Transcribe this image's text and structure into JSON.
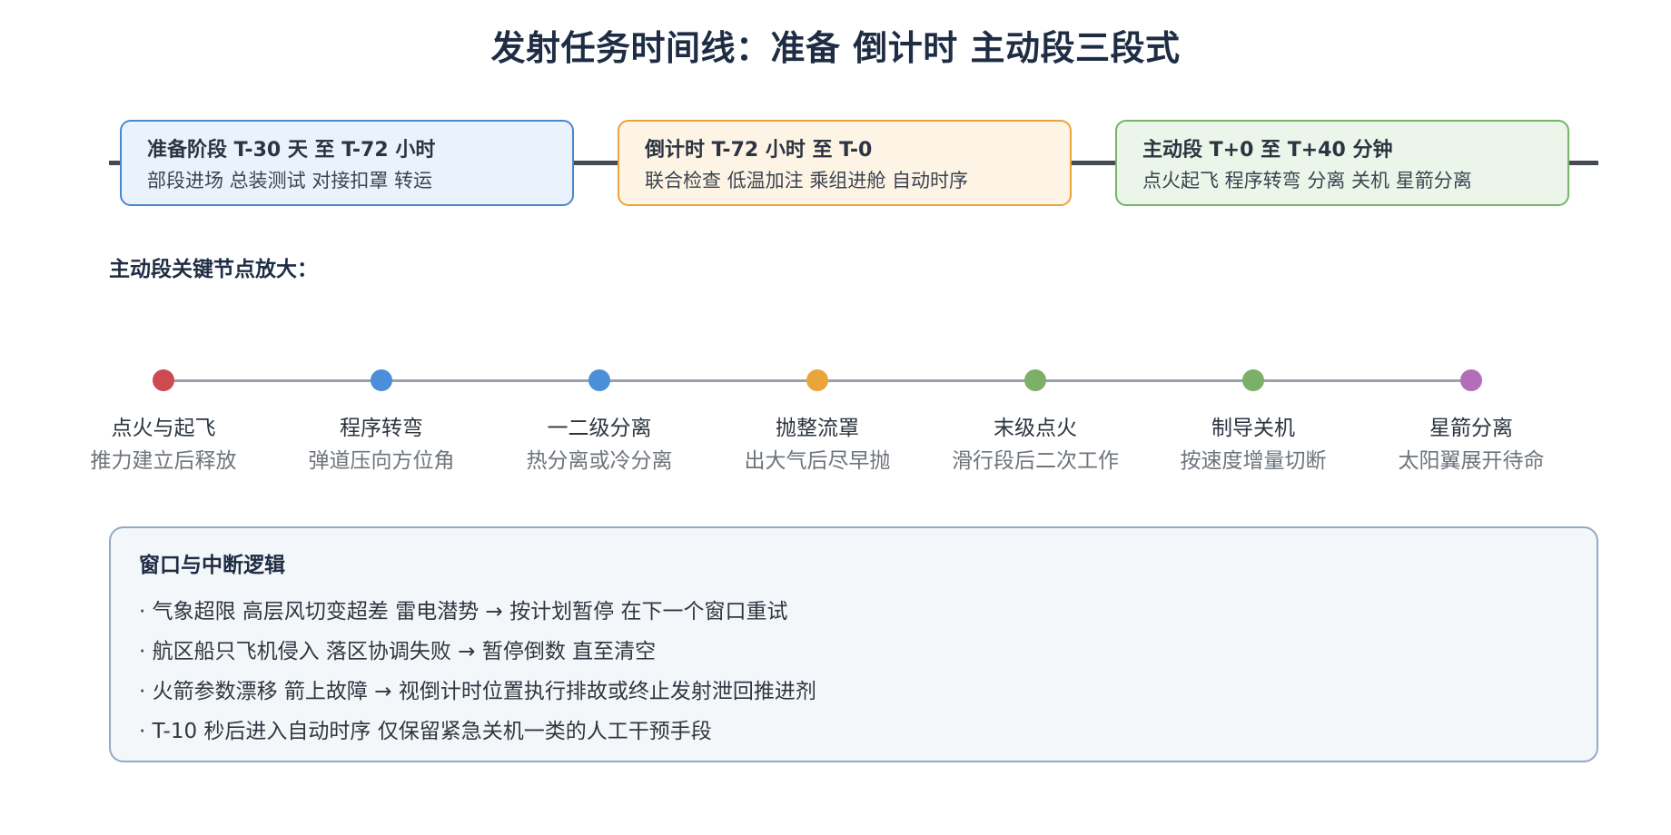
{
  "title": "发射任务时间线：准备 倒计时 主动段三段式",
  "phases": [
    {
      "title": "准备阶段 T-30 天 至 T-72 小时",
      "desc": "部段进场 总装测试 对接扣罩 转运",
      "color": "#4b87cc"
    },
    {
      "title": "倒计时 T-72 小时 至 T-0",
      "desc": "联合检查 低温加注 乘组进舱 自动时序",
      "color": "#e9a53a"
    },
    {
      "title": "主动段 T+0 至 T+40 分钟",
      "desc": "点火起飞 程序转弯 分离 关机 星箭分离",
      "color": "#77b36b"
    }
  ],
  "ascent_heading": "主动段关键节点放大：",
  "nodes": [
    {
      "label": "点火与起飞",
      "desc": "推力建立后释放",
      "color": "#cd4a50"
    },
    {
      "label": "程序转弯",
      "desc": "弹道压向方位角",
      "color": "#4b8fd8"
    },
    {
      "label": "一二级分离",
      "desc": "热分离或冷分离",
      "color": "#4b8fd8"
    },
    {
      "label": "抛整流罩",
      "desc": "出大气后尽早抛",
      "color": "#e9a53a"
    },
    {
      "label": "末级点火",
      "desc": "滑行段后二次工作",
      "color": "#7cb068"
    },
    {
      "label": "制导关机",
      "desc": "按速度增量切断",
      "color": "#7cb068"
    },
    {
      "label": "星箭分离",
      "desc": "太阳翼展开待命",
      "color": "#b36db9"
    }
  ],
  "logic": {
    "title": "窗口与中断逻辑",
    "items": [
      "· 气象超限 高层风切变超差 雷电潜势 → 按计划暂停 在下一个窗口重试",
      "· 航区船只飞机侵入 落区协调失败 → 暂停倒数 直至清空",
      "· 火箭参数漂移 箭上故障 → 视倒计时位置执行排故或终止发射泄回推进剂",
      "· T-10 秒后进入自动时序 仅保留紧急关机一类的人工干预手段"
    ]
  }
}
